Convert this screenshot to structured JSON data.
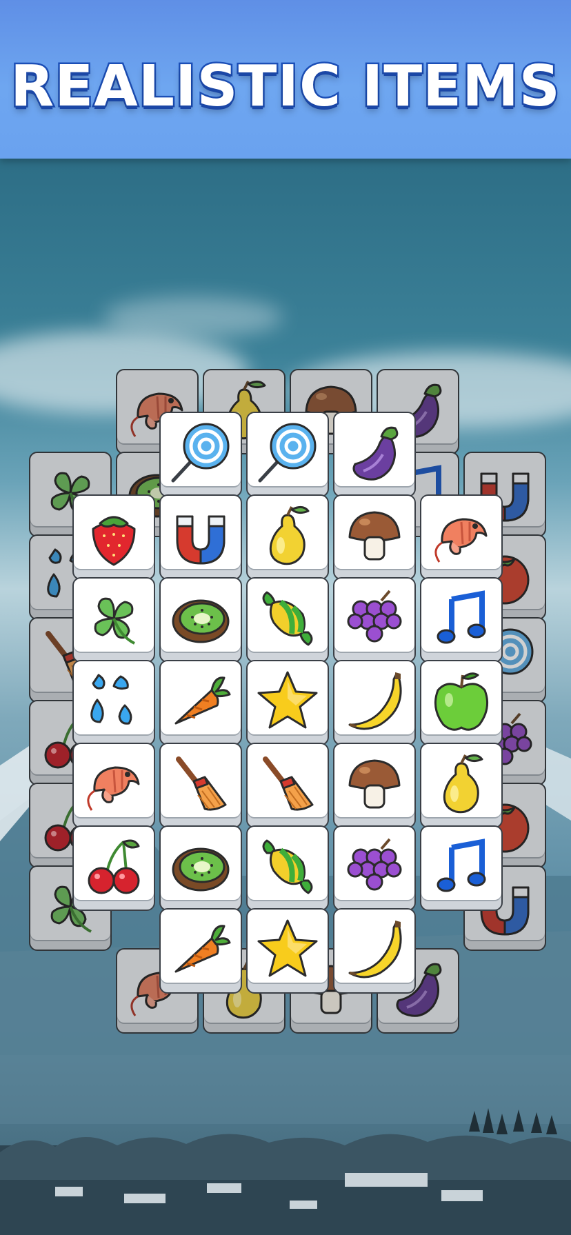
{
  "banner": {
    "title": "REALISTIC ITEMS"
  },
  "theme": {
    "banner_color": "#6ea6f0",
    "title_stroke": "#1c4fb8",
    "tile_face": "#ffffff",
    "tile_edge": "#3a3f46"
  },
  "board": {
    "layers": [
      {
        "name": "bottom",
        "tiles": [
          "shrimp",
          "pear",
          "mushroom",
          "eggplant",
          "clover",
          "kiwi",
          "music-note",
          "magnet",
          "water-drops",
          "tomato",
          "broom",
          "lollipop",
          "cherries",
          "grapes",
          "cherries",
          "tomato",
          "clover",
          "magnet",
          "shrimp",
          "pear",
          "mushroom",
          "eggplant"
        ]
      },
      {
        "name": "top",
        "tiles": [
          "lollipop",
          "lollipop",
          "eggplant",
          "strawberry",
          "magnet",
          "pear",
          "mushroom",
          "shrimp",
          "clover",
          "kiwi",
          "candy",
          "grapes",
          "music-note",
          "water-drops",
          "carrot",
          "star",
          "banana",
          "apple",
          "shrimp",
          "broom",
          "broom",
          "mushroom",
          "pear",
          "cherries",
          "kiwi",
          "candy",
          "grapes",
          "music-note",
          "carrot",
          "star",
          "banana"
        ]
      }
    ]
  }
}
